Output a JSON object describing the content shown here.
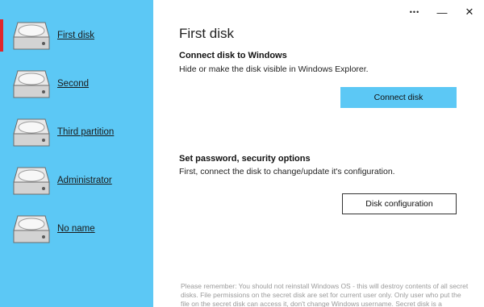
{
  "sidebar": {
    "items": [
      {
        "label": "First disk",
        "active": true
      },
      {
        "label": "Second",
        "active": false
      },
      {
        "label": "Third partition",
        "active": false
      },
      {
        "label": "Administrator",
        "active": false
      },
      {
        "label": "No name",
        "active": false
      }
    ],
    "background_color": "#5cc8f5",
    "active_indicator_color": "#e0262b"
  },
  "titlebar": {
    "more_icon": "more-dots-icon",
    "minimize_icon": "minimize-icon",
    "close_icon": "close-icon",
    "more_glyph": "•••",
    "minimize_glyph": "—",
    "close_glyph": "✕"
  },
  "main": {
    "page_title": "First disk",
    "connect_section": {
      "title": "Connect disk to Windows",
      "description": "Hide or make the disk visible in Windows Explorer.",
      "button_label": "Connect disk"
    },
    "security_section": {
      "title": "Set password, security options",
      "description": "First, connect the disk to change/update it's configuration.",
      "button_label": "Disk configuration"
    },
    "footer_note": "Please remember: You should not reinstall Windows OS - this will destroy contents of all secret disks. File permissions on the secret disk are set for current user only. Only user who put the file on the secret disk can access it, don't change Windows username. Secret disk is a"
  }
}
